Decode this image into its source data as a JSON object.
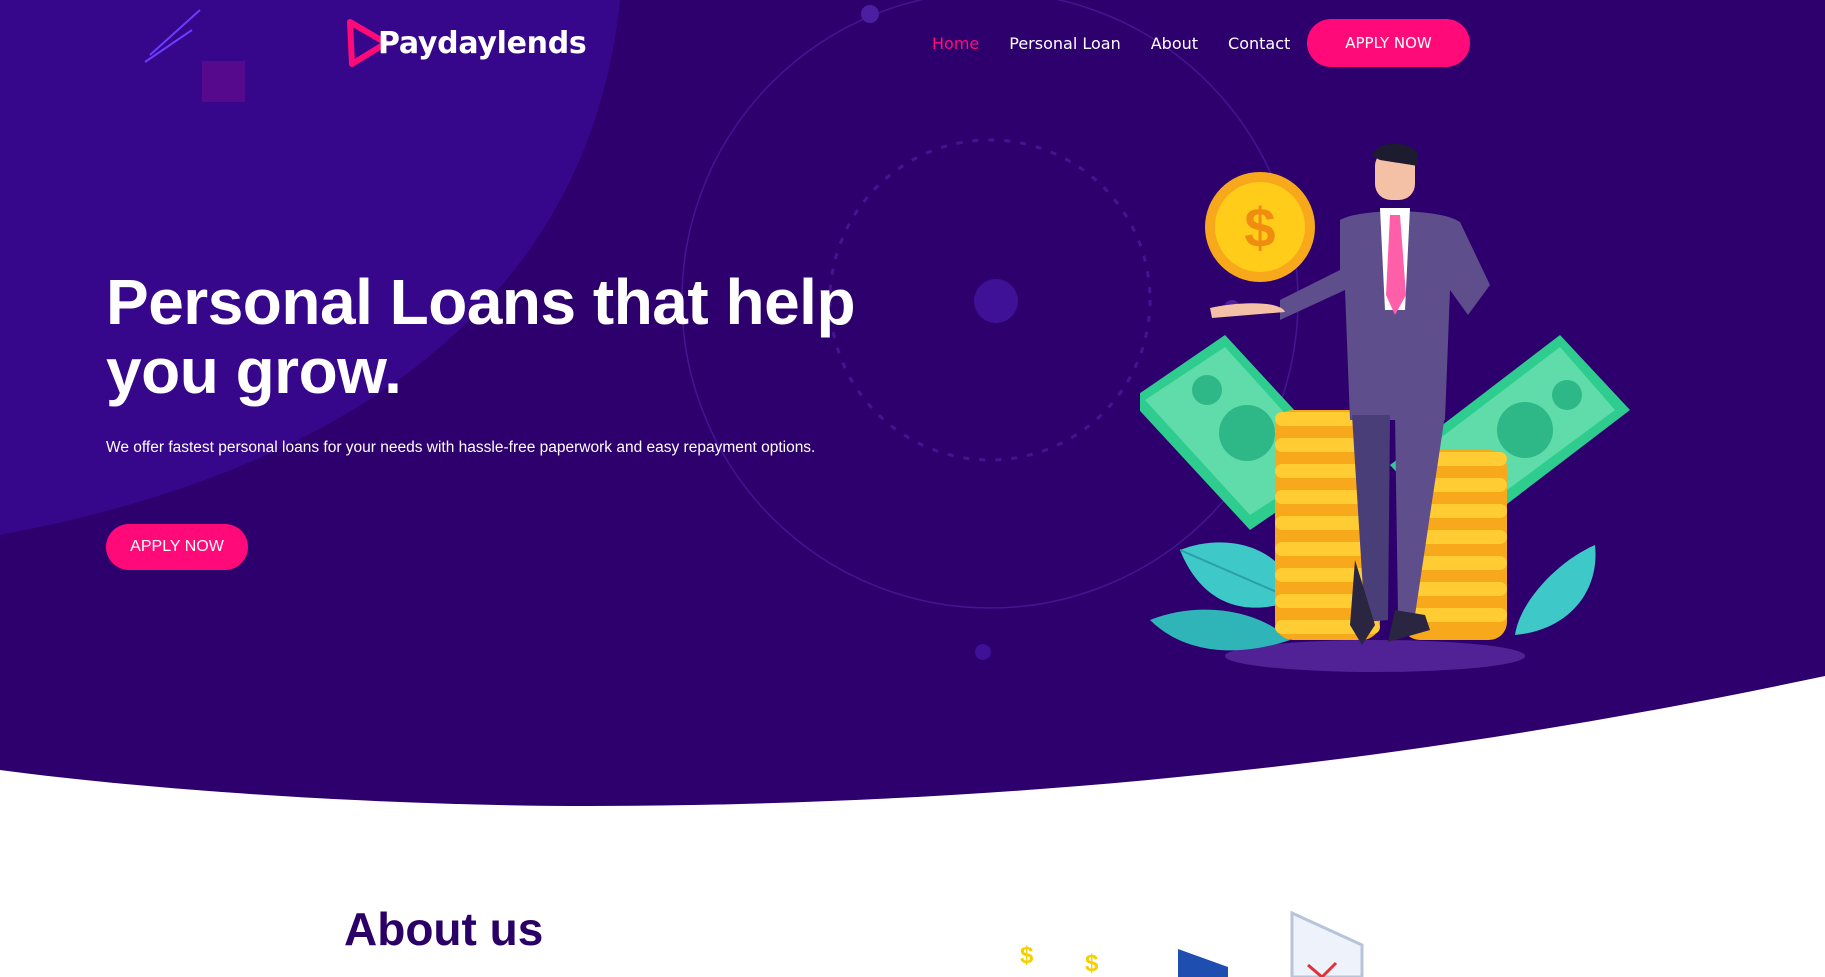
{
  "brand": {
    "name": "Paydaylends",
    "logo_icon": "play-triangle-icon"
  },
  "nav": {
    "items": [
      {
        "label": "Home",
        "active": true
      },
      {
        "label": "Personal Loan",
        "active": false
      },
      {
        "label": "About",
        "active": false
      },
      {
        "label": "Contact",
        "active": false
      }
    ],
    "apply_label": "APPLY NOW"
  },
  "hero": {
    "headline": "Personal Loans that help you grow.",
    "subtext": "We offer fastest personal loans for your needs with hassle-free paperwork and easy repayment options.",
    "apply_label": "APPLY NOW",
    "illustration": "businessman-with-coin-stacks-and-banknotes"
  },
  "about": {
    "title": "About us"
  },
  "colors": {
    "hero_background": "#2e006d",
    "accent": "#ff0a78",
    "heading_dark": "#2a0066"
  }
}
